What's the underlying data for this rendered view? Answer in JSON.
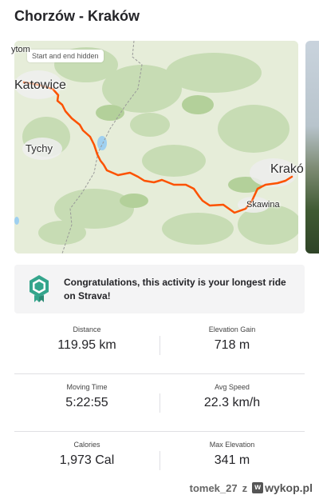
{
  "activity": {
    "title": "Chorzów - Kraków"
  },
  "map": {
    "privacy_label": "Start and end hidden",
    "places": {
      "bytom": "ytom",
      "katowice": "Katowice",
      "tychy": "Tychy",
      "krakow": "Krakó",
      "skawina": "Skawina"
    },
    "route_color": "#fc5200"
  },
  "achievement": {
    "message": "Congratulations, this activity is your longest ride on Strava!",
    "badge_color": "#34a58c"
  },
  "stats": [
    {
      "label": "Distance",
      "value": "119.95 km"
    },
    {
      "label": "Elevation Gain",
      "value": "718 m"
    },
    {
      "label": "Moving Time",
      "value": "5:22:55"
    },
    {
      "label": "Avg Speed",
      "value": "22.3 km/h"
    },
    {
      "label": "Calories",
      "value": "1,973 Cal"
    },
    {
      "label": "Max Elevation",
      "value": "341 m"
    }
  ],
  "watermark": {
    "user": "tomek_27",
    "sep": "z",
    "site": "wykop.pl"
  }
}
